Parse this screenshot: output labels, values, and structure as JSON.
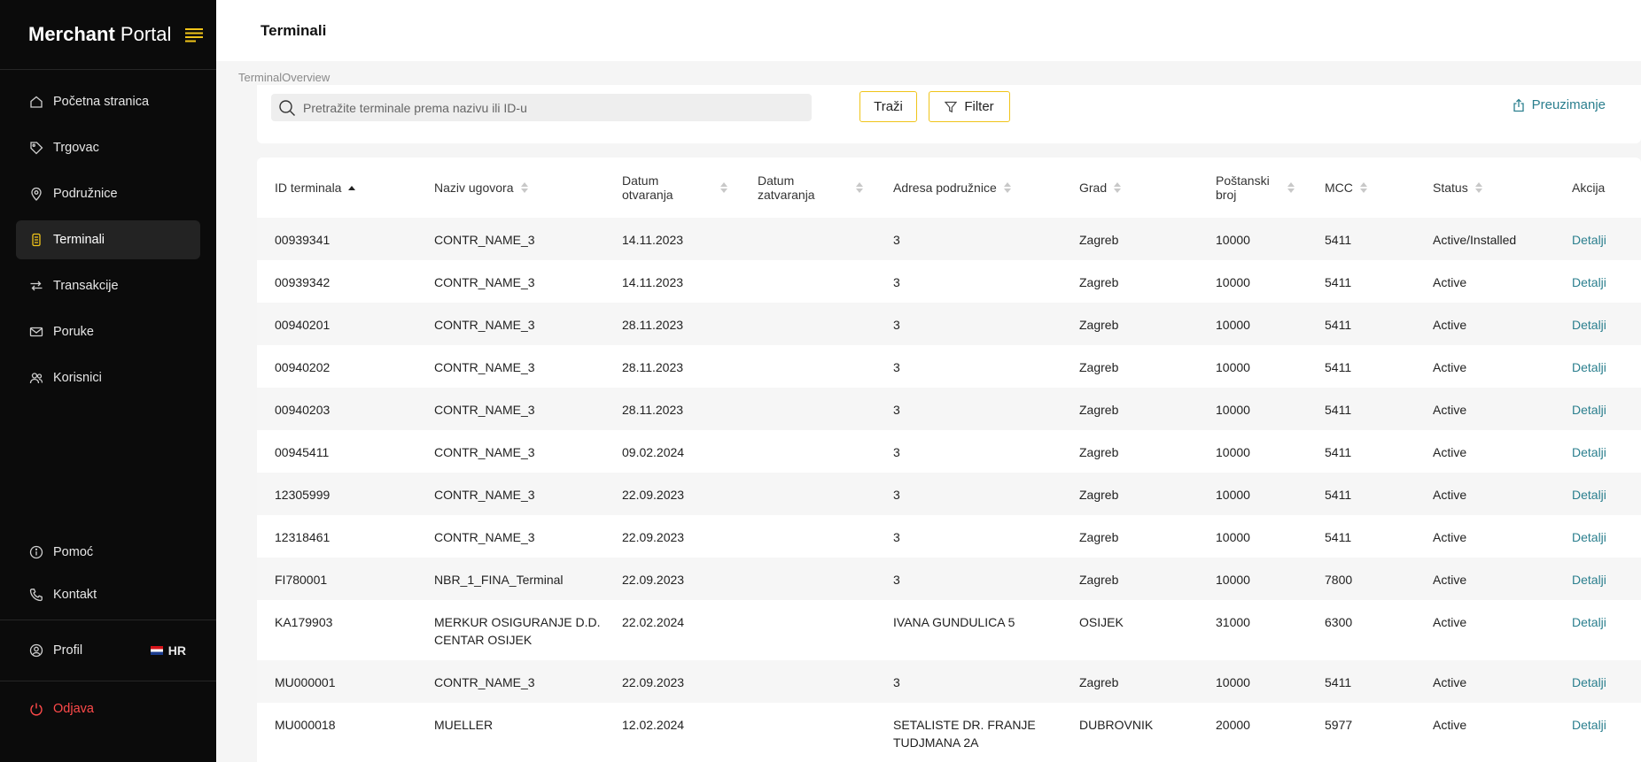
{
  "sidebar": {
    "brand_bold": "Merchant",
    "brand_light": "Portal",
    "items": [
      {
        "label": "Početna stranica",
        "icon": "home-icon"
      },
      {
        "label": "Trgovac",
        "icon": "tag-icon"
      },
      {
        "label": "Podružnice",
        "icon": "location-pin-icon"
      },
      {
        "label": "Terminali",
        "icon": "terminal-icon"
      },
      {
        "label": "Transakcije",
        "icon": "transfer-arrows-icon"
      },
      {
        "label": "Poruke",
        "icon": "mail-icon"
      },
      {
        "label": "Korisnici",
        "icon": "users-icon"
      }
    ],
    "help_label": "Pomoć",
    "contact_label": "Kontakt",
    "profile_label": "Profil",
    "language": "HR",
    "logout_label": "Odjava",
    "accent_color": "#f0c419",
    "logout_color": "#ff4a4a"
  },
  "header": {
    "title": "Terminali",
    "breadcrumb": "TerminalOverview"
  },
  "search": {
    "placeholder": "Pretražite terminale prema nazivu ili ID-u",
    "search_label": "Traži",
    "filter_label": "Filter",
    "download_label": "Preuzimanje",
    "link_color": "#2b7f8e"
  },
  "table": {
    "columns": [
      "ID terminala",
      "Naziv ugovora",
      "Datum otvaranja",
      "Datum zatvaranja",
      "Adresa podružnice",
      "Grad",
      "Poštanski broj",
      "MCC",
      "Status",
      "Akcija"
    ],
    "column_lines": {
      "datum_otvaranja": [
        "Datum",
        "otvaranja"
      ],
      "datum_zatvaranja": [
        "Datum",
        "zatvaranja"
      ],
      "postanski_broj": [
        "Poštanski",
        "broj"
      ]
    },
    "action_label": "Detalji",
    "rows": [
      {
        "id": "00939341",
        "contract": "CONTR_NAME_3",
        "opened": "14.11.2023",
        "closed": "",
        "address": "3",
        "city": "Zagreb",
        "zip": "10000",
        "mcc": "5411",
        "status": "Active/Installed"
      },
      {
        "id": "00939342",
        "contract": "CONTR_NAME_3",
        "opened": "14.11.2023",
        "closed": "",
        "address": "3",
        "city": "Zagreb",
        "zip": "10000",
        "mcc": "5411",
        "status": "Active"
      },
      {
        "id": "00940201",
        "contract": "CONTR_NAME_3",
        "opened": "28.11.2023",
        "closed": "",
        "address": "3",
        "city": "Zagreb",
        "zip": "10000",
        "mcc": "5411",
        "status": "Active"
      },
      {
        "id": "00940202",
        "contract": "CONTR_NAME_3",
        "opened": "28.11.2023",
        "closed": "",
        "address": "3",
        "city": "Zagreb",
        "zip": "10000",
        "mcc": "5411",
        "status": "Active"
      },
      {
        "id": "00940203",
        "contract": "CONTR_NAME_3",
        "opened": "28.11.2023",
        "closed": "",
        "address": "3",
        "city": "Zagreb",
        "zip": "10000",
        "mcc": "5411",
        "status": "Active"
      },
      {
        "id": "00945411",
        "contract": "CONTR_NAME_3",
        "opened": "09.02.2024",
        "closed": "",
        "address": "3",
        "city": "Zagreb",
        "zip": "10000",
        "mcc": "5411",
        "status": "Active"
      },
      {
        "id": "12305999",
        "contract": "CONTR_NAME_3",
        "opened": "22.09.2023",
        "closed": "",
        "address": "3",
        "city": "Zagreb",
        "zip": "10000",
        "mcc": "5411",
        "status": "Active"
      },
      {
        "id": "12318461",
        "contract": "CONTR_NAME_3",
        "opened": "22.09.2023",
        "closed": "",
        "address": "3",
        "city": "Zagreb",
        "zip": "10000",
        "mcc": "5411",
        "status": "Active"
      },
      {
        "id": "FI780001",
        "contract": "NBR_1_FINA_Terminal",
        "opened": "22.09.2023",
        "closed": "",
        "address": "3",
        "city": "Zagreb",
        "zip": "10000",
        "mcc": "7800",
        "status": "Active"
      },
      {
        "id": "KA179903",
        "contract": "MERKUR OSIGURANJE D.D. CENTAR OSIJEK",
        "opened": "22.02.2024",
        "closed": "",
        "address": "IVANA GUNDULICA 5",
        "city": "OSIJEK",
        "zip": "31000",
        "mcc": "6300",
        "status": "Active",
        "tall": true
      },
      {
        "id": "MU000001",
        "contract": "CONTR_NAME_3",
        "opened": "22.09.2023",
        "closed": "",
        "address": "3",
        "city": "Zagreb",
        "zip": "10000",
        "mcc": "5411",
        "status": "Active"
      },
      {
        "id": "MU000018",
        "contract": "MUELLER",
        "opened": "12.02.2024",
        "closed": "",
        "address": "SETALISTE DR. FRANJE TUDJMANA 2A",
        "city": "DUBROVNIK",
        "zip": "20000",
        "mcc": "5977",
        "status": "Active",
        "tall": true
      }
    ]
  }
}
